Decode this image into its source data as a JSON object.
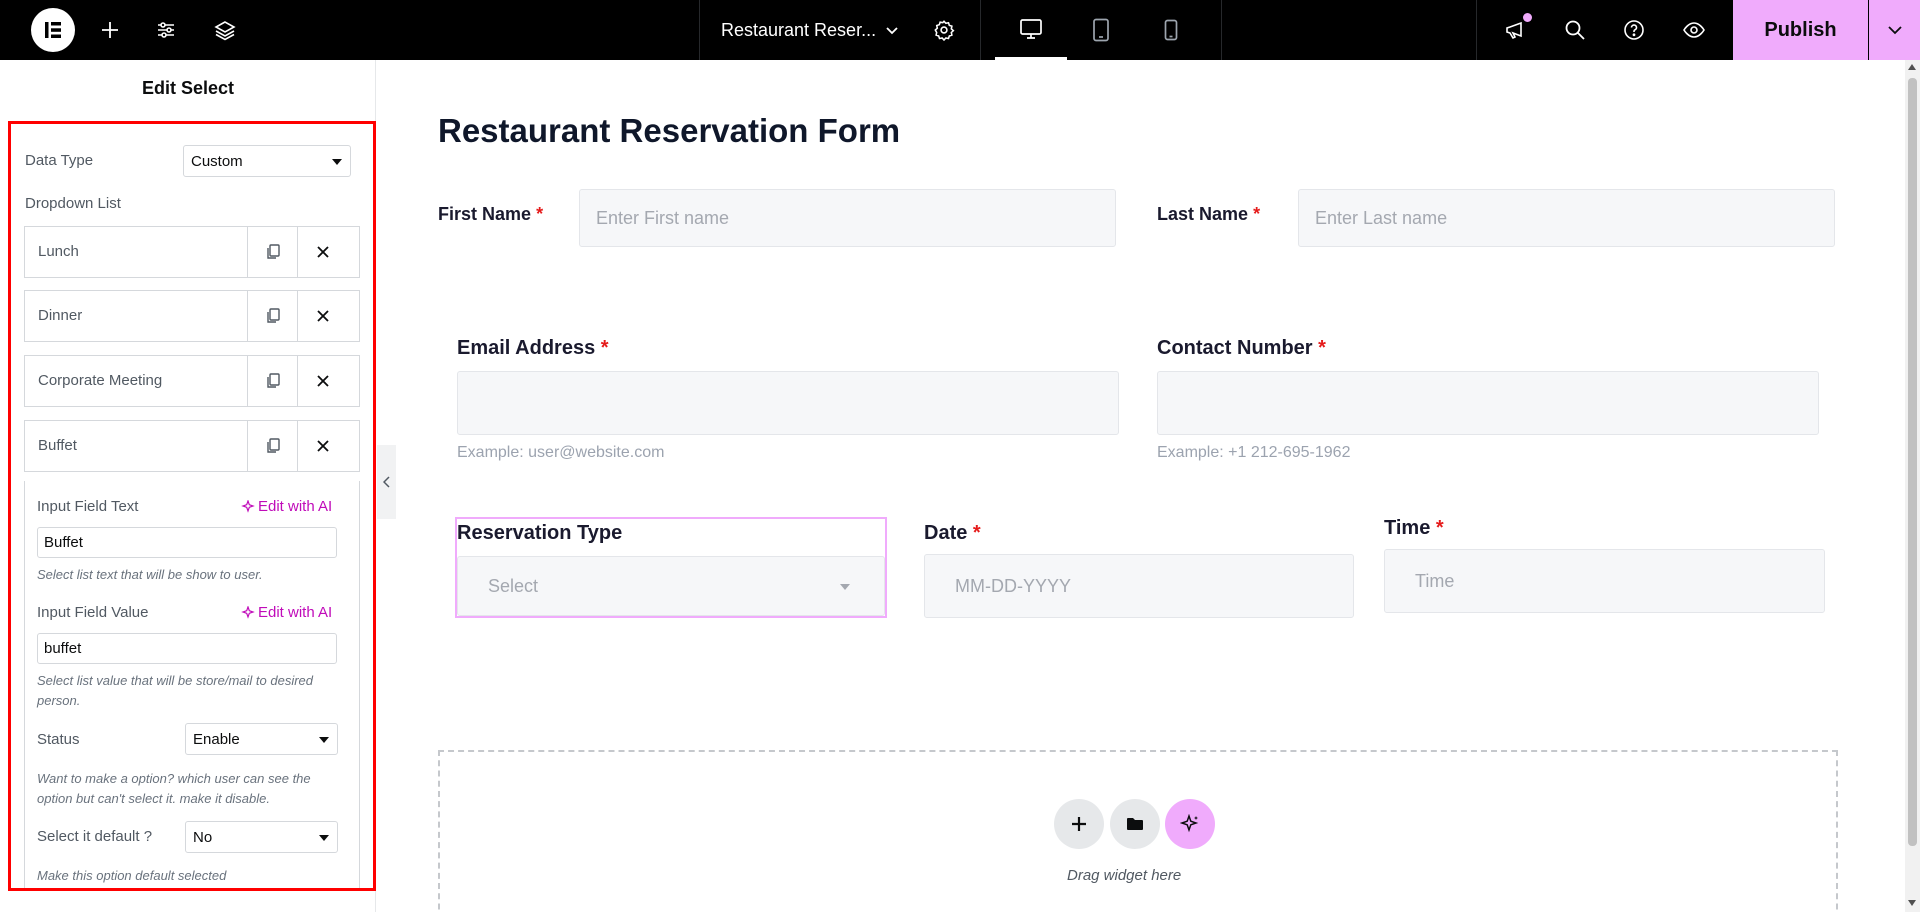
{
  "topbar": {
    "doc_title": "Restaurant Reser...",
    "publish_label": "Publish",
    "accent_color": "#f0abfc"
  },
  "panel": {
    "title": "Edit Select",
    "data_type_label": "Data Type",
    "data_type_value": "Custom",
    "dropdown_list_label": "Dropdown List",
    "items": [
      {
        "label": "Lunch"
      },
      {
        "label": "Dinner"
      },
      {
        "label": "Corporate Meeting"
      },
      {
        "label": "Buffet"
      }
    ],
    "input_text_label": "Input Field Text",
    "input_text_value": "Buffet",
    "input_text_hint": "Select list text that will be show to user.",
    "input_value_label": "Input Field Value",
    "input_value_value": "buffet",
    "input_value_hint": "Select list value that will be store/mail to desired person.",
    "edit_ai_label": "Edit with AI",
    "status_label": "Status",
    "status_value": "Enable",
    "status_hint": "Want to make a option? which user can see the option but can't select it. make it disable.",
    "default_label": "Select it default ?",
    "default_value": "No",
    "default_hint": "Make this option default selected"
  },
  "form": {
    "title": "Restaurant Reservation Form",
    "first_name_label": "First Name",
    "first_name_placeholder": "Enter First name",
    "last_name_label": "Last Name",
    "last_name_placeholder": "Enter Last name",
    "email_label": "Email Address",
    "email_hint": "Example: user@website.com",
    "contact_label": "Contact Number",
    "contact_hint": "Example: +1 212-695-1962",
    "reservation_label": "Reservation Type",
    "reservation_placeholder": "Select",
    "date_label": "Date",
    "date_placeholder": "MM-DD-YYYY",
    "time_label": "Time",
    "time_placeholder": "Time",
    "required_mark": "*",
    "drag_text": "Drag widget here"
  }
}
